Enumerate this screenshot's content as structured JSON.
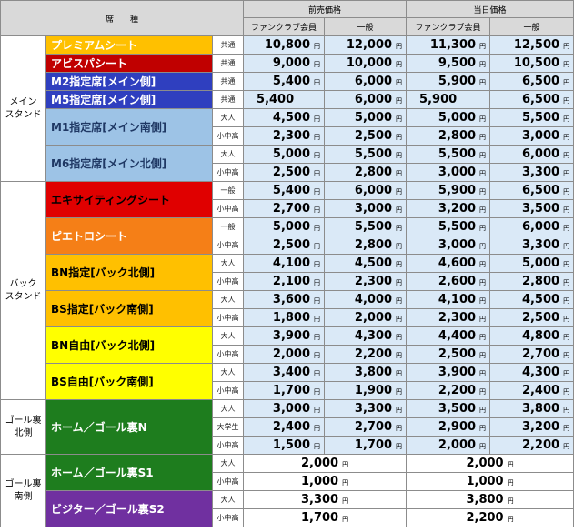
{
  "header": {
    "seat_type": "席　　種",
    "advance": "前売価格",
    "sameday": "当日価格",
    "fanclub": "ファンクラブ会員",
    "general": "一般"
  },
  "yen": "円",
  "areas": {
    "main": "メイン\nスタンド",
    "back": "バック\nスタンド",
    "goal_n": "ゴール裏\n北側",
    "goal_s": "ゴール裏\n南側"
  },
  "colors": {
    "header_bg": "#d9d9d9",
    "price_bg": "#dae9f7",
    "premium": "#ffc000",
    "abyss": "#c00000",
    "m_blue": "#2f3fbf",
    "m_light": "#9dc3e6",
    "exciting": "#e00000",
    "pietro": "#f57f17",
    "back_designated": "#ffc000",
    "back_free": "#ffff00",
    "goal": "#1e7d1e",
    "visitor": "#7030a0"
  },
  "rows": [
    {
      "seat": "プレミアムシート",
      "ticket": "共通",
      "adv_fc": "10,800",
      "adv_gen": "12,000",
      "day_fc": "11,300",
      "day_gen": "12,500"
    },
    {
      "seat": "アビスパシート",
      "ticket": "共通",
      "adv_fc": "9,000",
      "adv_gen": "10,000",
      "day_fc": "9,500",
      "day_gen": "10,500"
    },
    {
      "seat": "M2指定席[メイン側]",
      "ticket": "共通",
      "adv_fc": "5,400",
      "adv_gen": "6,000",
      "day_fc": "5,900",
      "day_gen": "6,500"
    },
    {
      "seat": "M5指定席[メイン側]",
      "ticket": "共通",
      "adv_fc": "5,400",
      "adv_gen": "6,000",
      "day_fc": "5,900",
      "day_gen": "6,500"
    },
    {
      "seat": "M1指定席[メイン南側]",
      "ticket": "大人",
      "adv_fc": "4,500",
      "adv_gen": "5,000",
      "day_fc": "5,000",
      "day_gen": "5,500"
    },
    {
      "ticket": "小中高",
      "adv_fc": "2,300",
      "adv_gen": "2,500",
      "day_fc": "2,800",
      "day_gen": "3,000"
    },
    {
      "seat": "M6指定席[メイン北側]",
      "ticket": "大人",
      "adv_fc": "5,000",
      "adv_gen": "5,500",
      "day_fc": "5,500",
      "day_gen": "6,000"
    },
    {
      "ticket": "小中高",
      "adv_fc": "2,500",
      "adv_gen": "2,800",
      "day_fc": "3,000",
      "day_gen": "3,300"
    },
    {
      "seat": "エキサイティングシート",
      "ticket": "一般",
      "adv_fc": "5,400",
      "adv_gen": "6,000",
      "day_fc": "5,900",
      "day_gen": "6,500"
    },
    {
      "ticket": "小中高",
      "adv_fc": "2,700",
      "adv_gen": "3,000",
      "day_fc": "3,200",
      "day_gen": "3,500"
    },
    {
      "seat": "ピエトロシート",
      "ticket": "一般",
      "adv_fc": "5,000",
      "adv_gen": "5,500",
      "day_fc": "5,500",
      "day_gen": "6,000"
    },
    {
      "ticket": "小中高",
      "adv_fc": "2,500",
      "adv_gen": "2,800",
      "day_fc": "3,000",
      "day_gen": "3,300"
    },
    {
      "seat": "BN指定[バック北側]",
      "ticket": "大人",
      "adv_fc": "4,100",
      "adv_gen": "4,500",
      "day_fc": "4,600",
      "day_gen": "5,000"
    },
    {
      "ticket": "小中高",
      "adv_fc": "2,100",
      "adv_gen": "2,300",
      "day_fc": "2,600",
      "day_gen": "2,800"
    },
    {
      "seat": "BS指定[バック南側]",
      "ticket": "大人",
      "adv_fc": "3,600",
      "adv_gen": "4,000",
      "day_fc": "4,100",
      "day_gen": "4,500"
    },
    {
      "ticket": "小中高",
      "adv_fc": "1,800",
      "adv_gen": "2,000",
      "day_fc": "2,300",
      "day_gen": "2,500"
    },
    {
      "seat": "BN自由[バック北側]",
      "ticket": "大人",
      "adv_fc": "3,900",
      "adv_gen": "4,300",
      "day_fc": "4,400",
      "day_gen": "4,800"
    },
    {
      "ticket": "小中高",
      "adv_fc": "2,000",
      "adv_gen": "2,200",
      "day_fc": "2,500",
      "day_gen": "2,700"
    },
    {
      "seat": "BS自由[バック南側]",
      "ticket": "大人",
      "adv_fc": "3,400",
      "adv_gen": "3,800",
      "day_fc": "3,900",
      "day_gen": "4,300"
    },
    {
      "ticket": "小中高",
      "adv_fc": "1,700",
      "adv_gen": "1,900",
      "day_fc": "2,200",
      "day_gen": "2,400"
    },
    {
      "seat": "ホーム／ゴール裏N",
      "ticket": "大人",
      "adv_fc": "3,000",
      "adv_gen": "3,300",
      "day_fc": "3,500",
      "day_gen": "3,800"
    },
    {
      "ticket": "大学生",
      "adv_fc": "2,400",
      "adv_gen": "2,700",
      "day_fc": "2,900",
      "day_gen": "3,200"
    },
    {
      "ticket": "小中高",
      "adv_fc": "1,500",
      "adv_gen": "1,700",
      "day_fc": "2,000",
      "day_gen": "2,200"
    },
    {
      "seat": "ホーム／ゴール裏S1",
      "ticket": "大人",
      "adv": "2,000",
      "day": "2,000"
    },
    {
      "ticket": "小中高",
      "adv": "1,000",
      "day": "1,000"
    },
    {
      "seat": "ビジター／ゴール裏S2",
      "ticket": "大人",
      "adv": "3,300",
      "day": "3,800"
    },
    {
      "ticket": "小中高",
      "adv": "1,700",
      "day": "2,200"
    }
  ]
}
